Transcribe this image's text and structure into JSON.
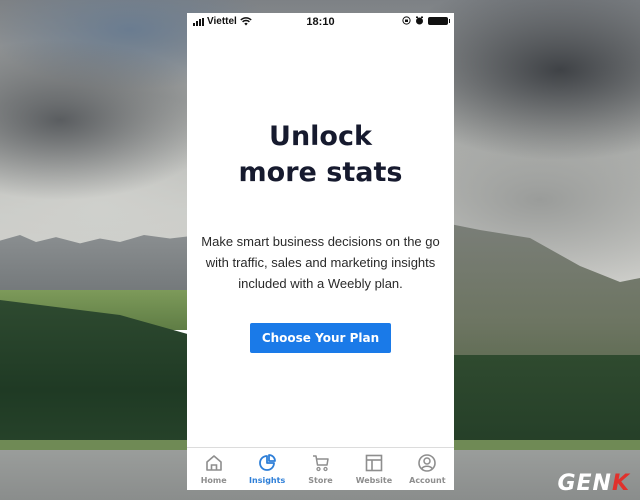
{
  "status_bar": {
    "carrier": "Viettel",
    "time": "18:10",
    "icons": [
      "signal-icon",
      "wifi-icon",
      "orientation-lock-icon",
      "alarm-icon",
      "battery-icon"
    ]
  },
  "main": {
    "headline_line1": "Unlock",
    "headline_line2": "more stats",
    "description": "Make smart business decisions on the go with traffic, sales and marketing insights included with a Weebly plan.",
    "cta_label": "Choose Your Plan"
  },
  "tabbar": {
    "items": [
      {
        "label": "Home",
        "icon": "home-icon",
        "active": false
      },
      {
        "label": "Insights",
        "icon": "pie-chart-icon",
        "active": true
      },
      {
        "label": "Store",
        "icon": "cart-icon",
        "active": false
      },
      {
        "label": "Website",
        "icon": "layout-icon",
        "active": false
      },
      {
        "label": "Account",
        "icon": "user-circle-icon",
        "active": false
      }
    ]
  },
  "colors": {
    "accent": "#1a7ae8",
    "active_tab": "#2e7fd8",
    "inactive_tab": "#8e8e8e",
    "headline": "#161a2e"
  },
  "watermark": {
    "text_main": "GEN",
    "text_accent": "K"
  }
}
